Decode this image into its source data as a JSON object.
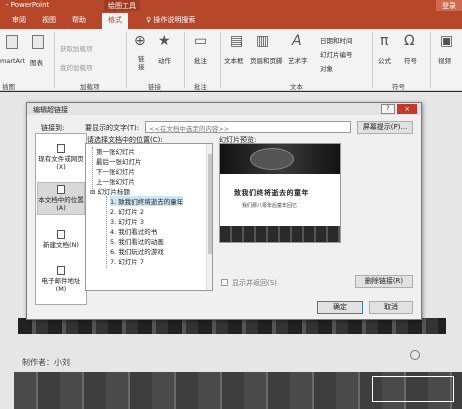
{
  "titlebar": {
    "app": "- PowerPoint",
    "context": "绘图工具",
    "login": "登录"
  },
  "tabs": {
    "t1": "审阅",
    "t2": "视图",
    "t3": "帮助",
    "t4": "格式",
    "tellme": "操作说明搜索"
  },
  "ribbon": {
    "smartart": "martArt",
    "chart": "图表",
    "get_addins": "获取加载项",
    "my_addins": "我的加载项",
    "link": "链\n接",
    "action": "动作",
    "comment": "批注",
    "textbox": "文本框",
    "header_footer": "页眉和页脚",
    "wordart": "艺术字",
    "datetime": "日期和时间",
    "slidenum": "幻灯片编号",
    "object": "对象",
    "formula": "公式",
    "symbol": "符号",
    "video": "视频",
    "g_illus": "插图",
    "g_addins": "加载项",
    "g_links": "链接",
    "g_comments": "批注",
    "g_text": "文本",
    "g_symbols": "符号"
  },
  "dialog": {
    "title": "编辑超链接",
    "help": "?",
    "close": "×",
    "link_to_label": "链接到:",
    "display_text_label": "要显示的文字(T):",
    "display_text_value": "<<在文档中选定的内容>>",
    "screentip_btn": "屏幕提示(P)...",
    "select_place_label": "请选择文档中的位置(C):",
    "preview_label": "幻灯片预览:",
    "link_to": [
      {
        "label": "现有文件或网页(X)"
      },
      {
        "label": "本文档中的位置(A)"
      },
      {
        "label": "新建文档(N)"
      },
      {
        "label": "电子邮件地址(M)"
      }
    ],
    "places": [
      "第一张幻灯片",
      "最后一张幻灯片",
      "下一张幻灯片",
      "上一张幻灯片",
      "幻灯片标题",
      "1. 致我们终将逝去的童年",
      "2. 幻灯片 2",
      "3. 幻灯片 3",
      "4. 我们看过的书",
      "5. 我们看过的动画",
      "6. 我们玩过的游戏",
      "7. 幻灯片 7"
    ],
    "preview_title": "致我们终将逝去的童年",
    "preview_sub": "我们那八零年后童年回忆",
    "show_return": "显示并返回(S)",
    "remove_link": "删除链接(R)",
    "ok": "确定",
    "cancel": "取消"
  },
  "slide": {
    "author": "制作者：小刘"
  }
}
